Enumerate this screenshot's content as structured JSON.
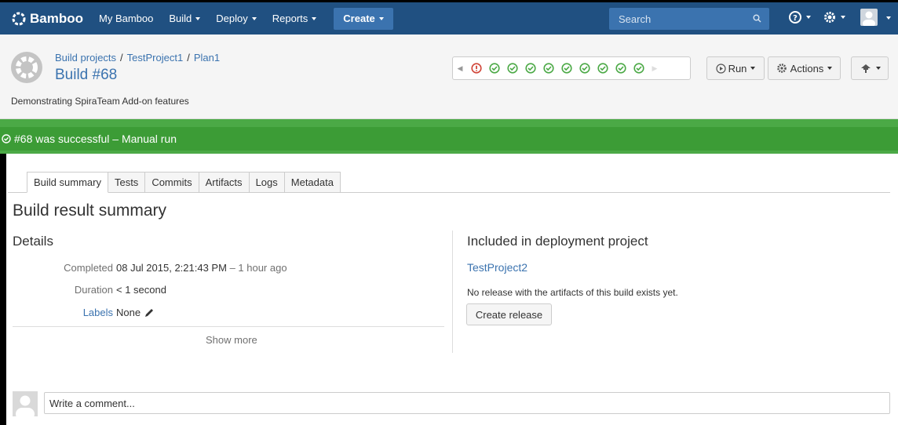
{
  "nav": {
    "logo_text": "Bamboo",
    "links": [
      {
        "label": "My Bamboo",
        "caret": false
      },
      {
        "label": "Build",
        "caret": true
      },
      {
        "label": "Deploy",
        "caret": true
      },
      {
        "label": "Reports",
        "caret": true
      }
    ],
    "create_label": "Create",
    "search_placeholder": "Search",
    "icons": [
      "help-icon",
      "gear-icon",
      "user-avatar"
    ]
  },
  "header": {
    "breadcrumbs": [
      "Build projects",
      "TestProject1",
      "Plan1"
    ],
    "title": "Build #68",
    "description": "Demonstrating SpiraTeam Add-on features",
    "history": [
      "failed",
      "success",
      "success",
      "success",
      "success",
      "success",
      "success",
      "success",
      "success",
      "success"
    ],
    "run_label": "Run",
    "actions_label": "Actions"
  },
  "status": {
    "text": "#68 was successful – Manual run",
    "color": "#3c9c36"
  },
  "tabs": [
    {
      "label": "Build summary",
      "active": true
    },
    {
      "label": "Tests",
      "active": false
    },
    {
      "label": "Commits",
      "active": false
    },
    {
      "label": "Artifacts",
      "active": false
    },
    {
      "label": "Logs",
      "active": false
    },
    {
      "label": "Metadata",
      "active": false
    }
  ],
  "summary": {
    "heading": "Build result summary",
    "details_heading": "Details",
    "completed_label": "Completed",
    "completed_value": "08 Jul 2015, 2:21:43 PM",
    "completed_ago": "– 1 hour ago",
    "duration_label": "Duration",
    "duration_value": "< 1 second",
    "labels_label": "Labels",
    "labels_value": "None",
    "show_more": "Show more"
  },
  "deployment": {
    "heading": "Included in deployment project",
    "project_link": "TestProject2",
    "message": "No release with the artifacts of this build exists yet.",
    "create_release_label": "Create release"
  },
  "comment": {
    "placeholder": "Write a comment..."
  },
  "colors": {
    "nav_bg": "#205081",
    "link": "#3b73af",
    "success": "#4ba946",
    "failed": "#d04437"
  }
}
